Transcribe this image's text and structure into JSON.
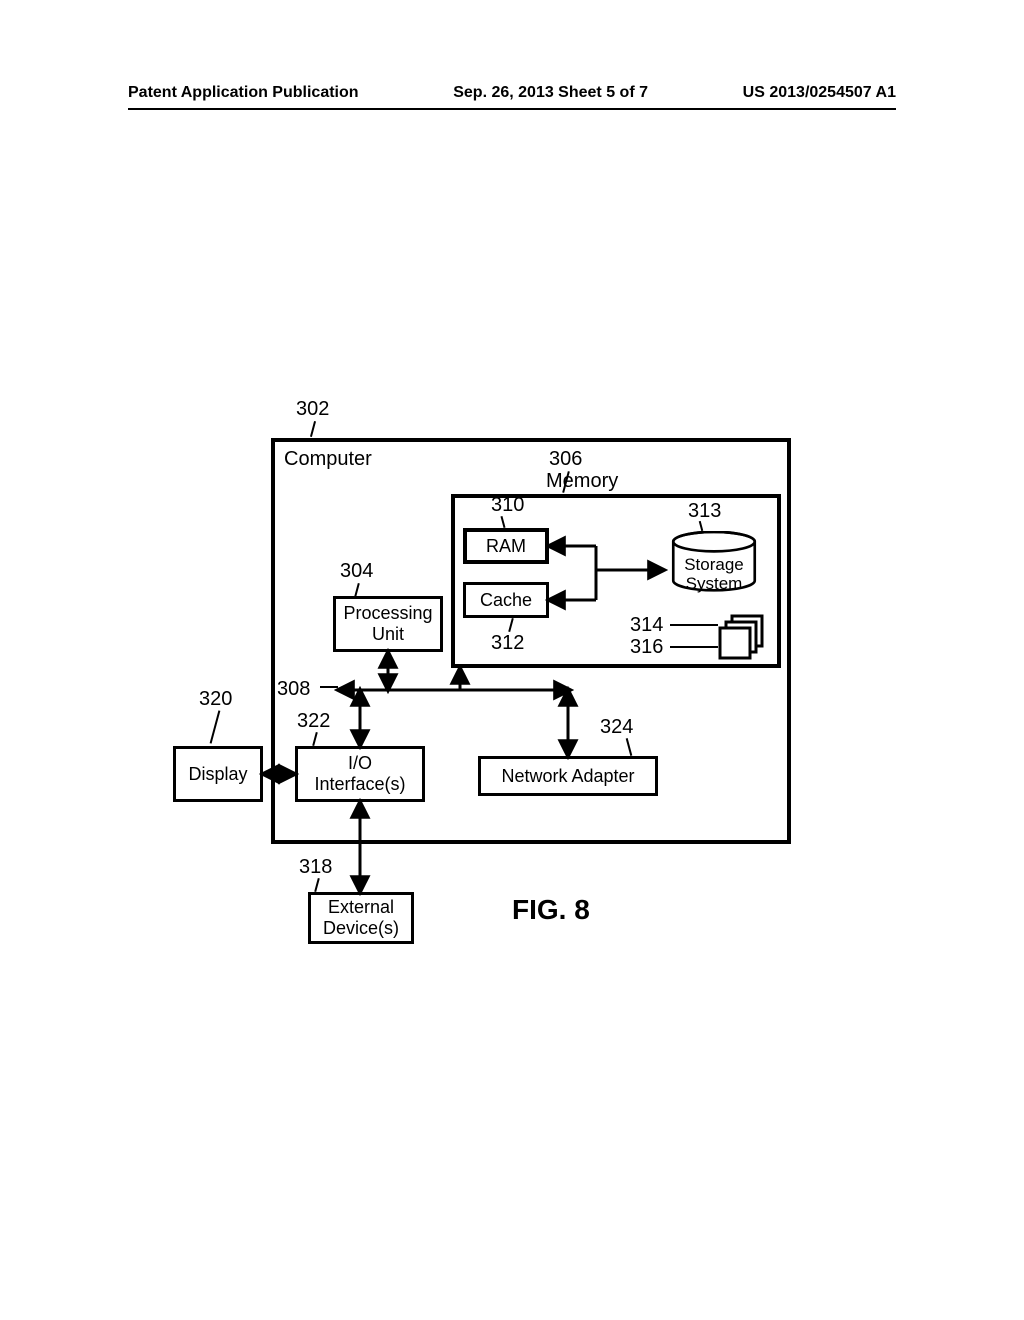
{
  "header": {
    "left": "Patent Application Publication",
    "center": "Sep. 26, 2013  Sheet 5 of 7",
    "right": "US 2013/0254507 A1"
  },
  "refs": {
    "computer": "302",
    "processing_unit": "304",
    "memory": "306",
    "bus": "308",
    "ram": "310",
    "cache": "312",
    "storage_system": "313",
    "docs_a": "314",
    "docs_b": "316",
    "external_devices": "318",
    "display": "320",
    "io_interfaces": "322",
    "network_adapter": "324"
  },
  "blocks": {
    "computer": "Computer",
    "memory": "Memory",
    "ram": "RAM",
    "cache": "Cache",
    "processing_unit": "Processing\nUnit",
    "io_interfaces": "I/O\nInterface(s)",
    "network_adapter": "Network Adapter",
    "display": "Display",
    "external_devices": "External\nDevice(s)",
    "storage_system": "Storage\nSystem"
  },
  "figure": {
    "label": "FIG. 8"
  }
}
